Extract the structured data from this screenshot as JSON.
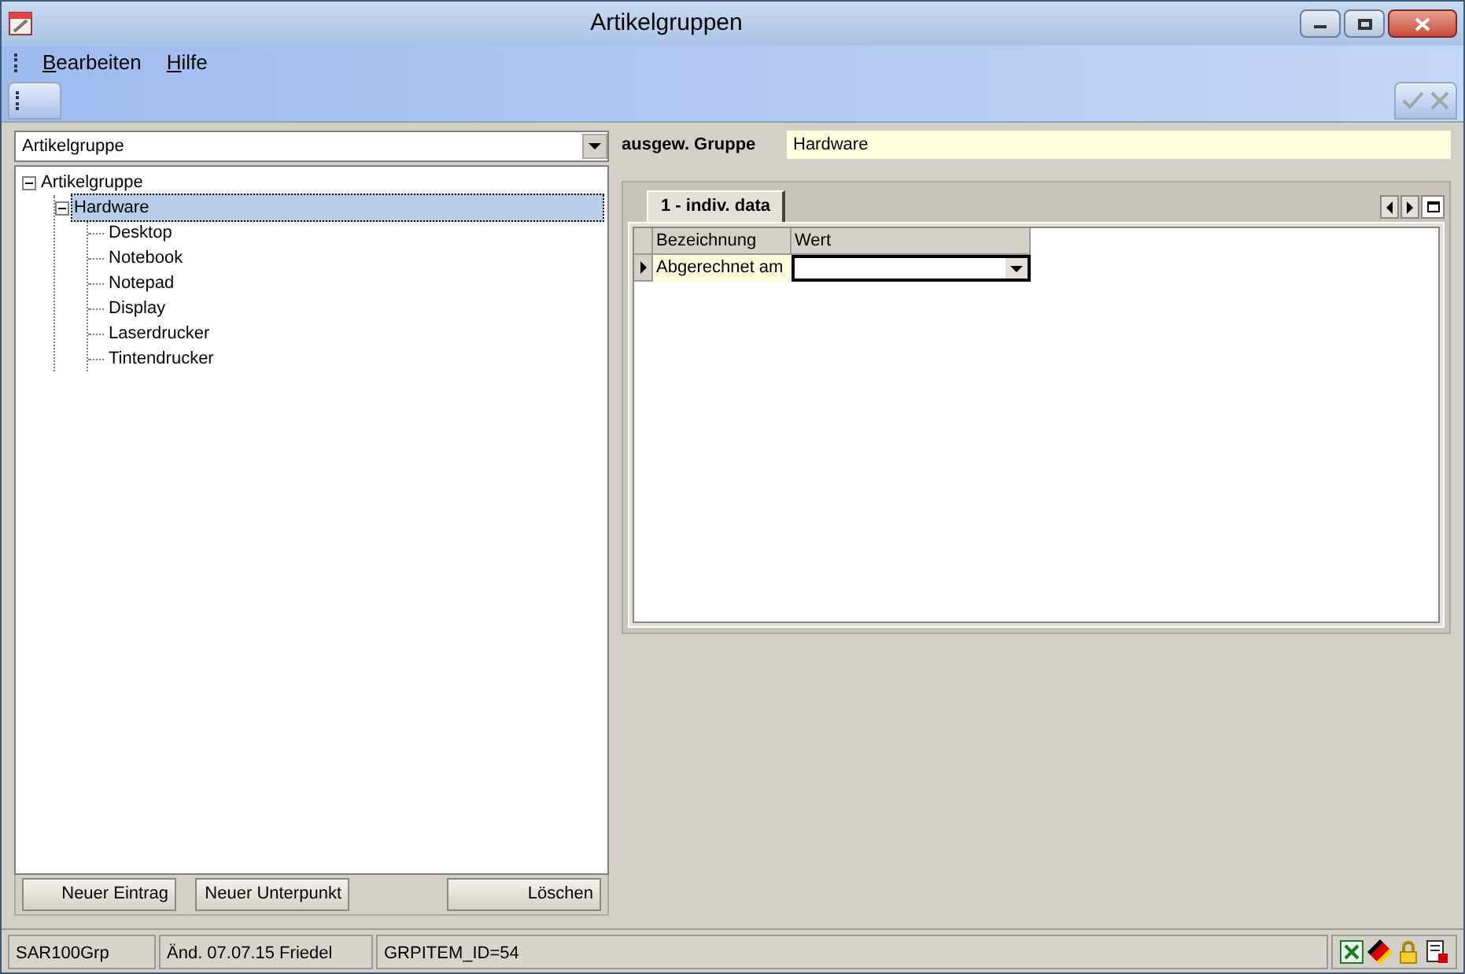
{
  "window": {
    "title": "Artikelgruppen"
  },
  "menu": [
    "Bearbeiten",
    "Hilfe"
  ],
  "group_select": {
    "value": "Artikelgruppe"
  },
  "tree": [
    {
      "label": "Artikelgruppe",
      "expanded": true,
      "selected": false,
      "children": [
        {
          "label": "Hardware",
          "expanded": true,
          "selected": true,
          "children": [
            {
              "label": "Desktop",
              "selected": false
            },
            {
              "label": "Notebook",
              "selected": false
            },
            {
              "label": "Notepad",
              "selected": false
            },
            {
              "label": "Display",
              "selected": false
            },
            {
              "label": "Laserdrucker",
              "selected": false
            },
            {
              "label": "Tintendrucker",
              "selected": false
            }
          ]
        }
      ]
    }
  ],
  "tree_buttons": [
    "Neuer Eintrag",
    "Neuer Unterpunkt",
    "Löschen"
  ],
  "selected_group": {
    "label": "ausgew. Gruppe",
    "value": "Hardware"
  },
  "tabs": [
    {
      "label": "1 - indiv. data",
      "selected": true
    }
  ],
  "grid": {
    "columns": [
      "Bezeichnung",
      "Wert"
    ],
    "rows": [
      {
        "cells": [
          "Abgerechnet am"
        ],
        "selected": true
      }
    ]
  },
  "status_bar": [
    "SAR100Grp",
    "Änd. 07.07.15 Friedel",
    "GRPITEM_ID=54"
  ]
}
